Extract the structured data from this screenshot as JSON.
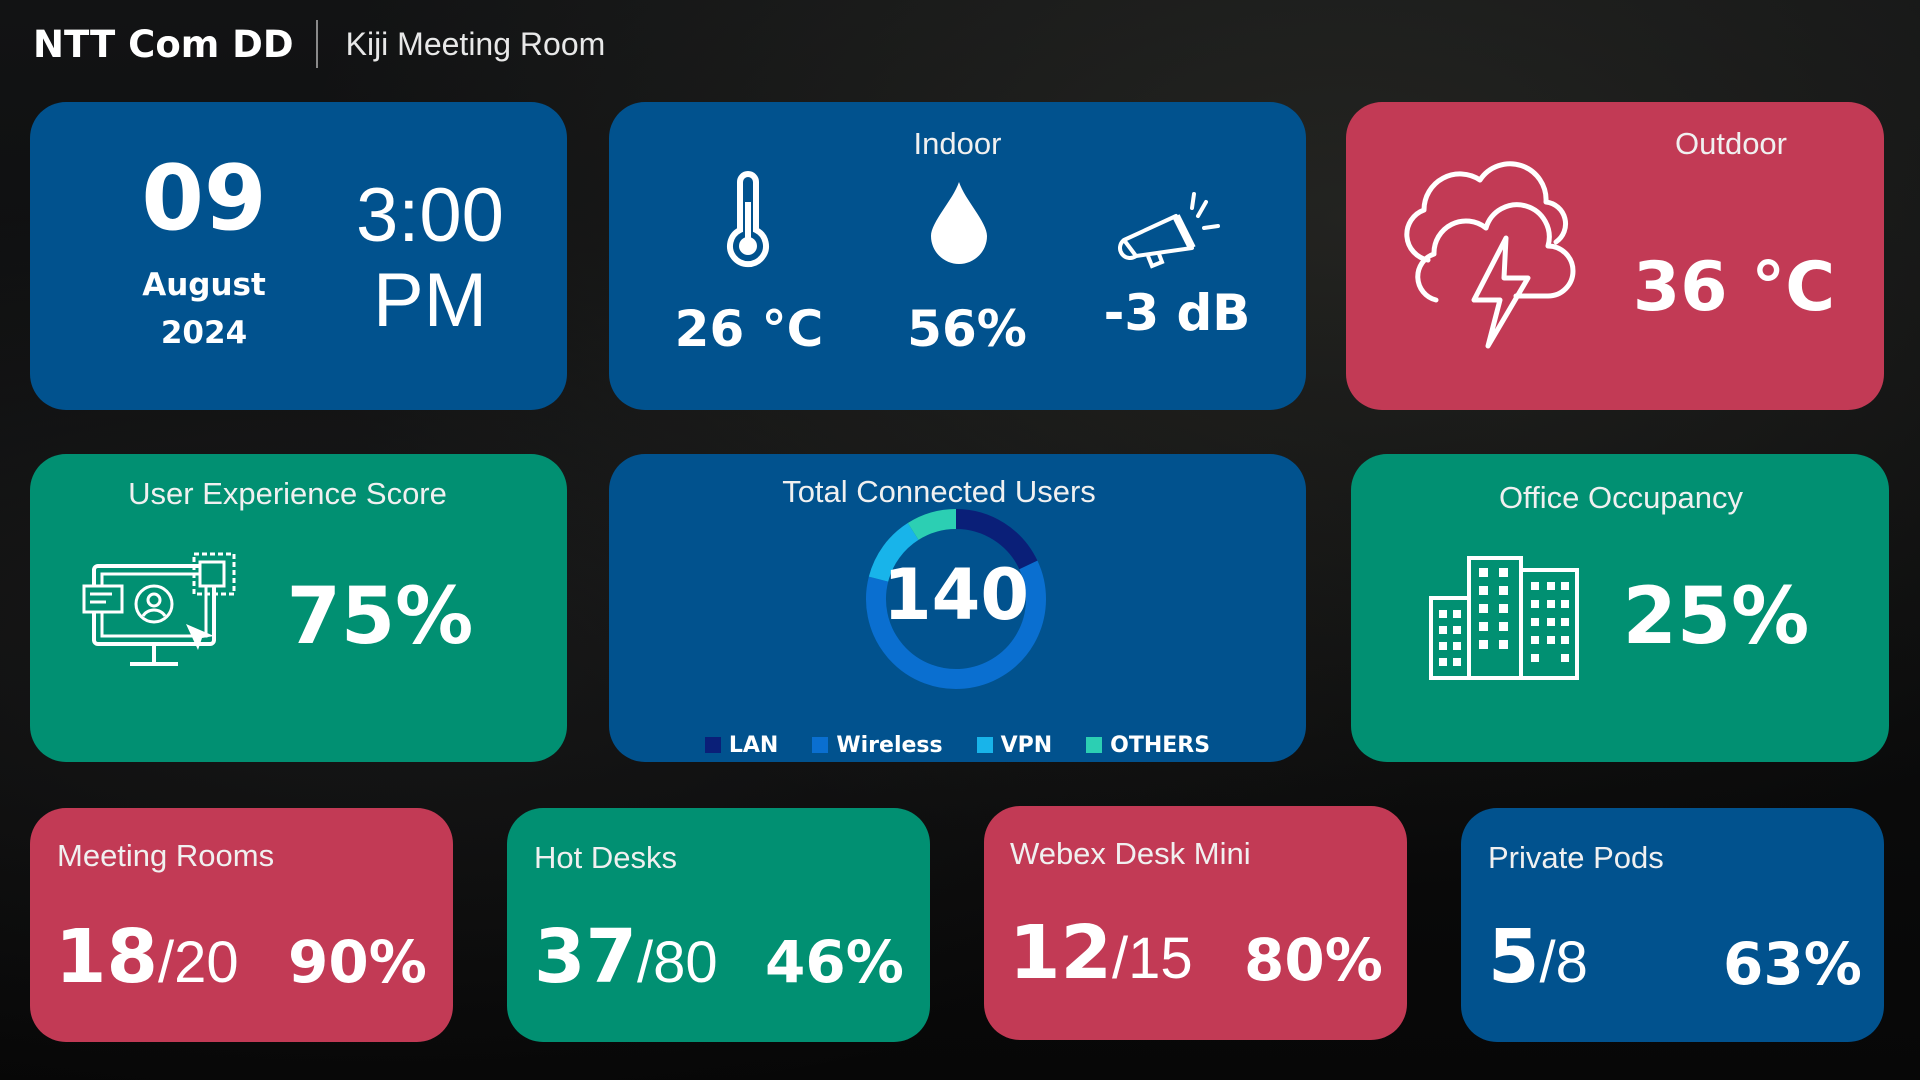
{
  "header": {
    "brand": "NTT Com DD",
    "room": "Kiji Meeting Room"
  },
  "datetime": {
    "day": "09",
    "month": "August",
    "year": "2024",
    "time": "3:00",
    "ampm": "PM"
  },
  "indoor": {
    "title": "Indoor",
    "temperature": "26 °C",
    "humidity": "56%",
    "noise": "-3 dB",
    "icons": [
      "thermometer-icon",
      "water-drop-icon",
      "megaphone-icon"
    ]
  },
  "outdoor": {
    "title": "Outdoor",
    "temperature": "36 °C",
    "icon": "thunderstorm-cloud-icon"
  },
  "user_experience": {
    "title": "User Experience Score",
    "value": "75%",
    "icon": "user-screen-icon"
  },
  "connected_users": {
    "title": "Total Connected Users",
    "total": "140",
    "legend": [
      {
        "label": "LAN",
        "color": "#0a1f78"
      },
      {
        "label": "Wireless",
        "color": "#0a6fd0"
      },
      {
        "label": "VPN",
        "color": "#18b4ea"
      },
      {
        "label": "OTHERS",
        "color": "#2ccfb3"
      }
    ]
  },
  "chart_data": {
    "type": "pie",
    "categories": [
      "LAN",
      "Wireless",
      "VPN",
      "OTHERS"
    ],
    "values": [
      0.18,
      0.61,
      0.12,
      0.09
    ],
    "center_label": "140",
    "title": "Total Connected Users",
    "legend_position": "bottom"
  },
  "office_occupancy": {
    "title": "Office Occupancy",
    "value": "25%",
    "icon": "buildings-icon"
  },
  "meeting_rooms": {
    "title": "Meeting Rooms",
    "used": "18",
    "sep": "/",
    "total": "20",
    "pct": "90%"
  },
  "hot_desks": {
    "title": "Hot Desks",
    "used": "37",
    "sep": "/",
    "total": "80",
    "pct": "46%"
  },
  "webex_desk_mini": {
    "title": "Webex Desk Mini",
    "used": "12",
    "sep": "/",
    "total": "15",
    "pct": "80%"
  },
  "private_pods": {
    "title": "Private Pods",
    "used": "5",
    "sep": "/",
    "total": "8",
    "pct": "63%"
  },
  "colors": {
    "blue": "#01528e",
    "red": "#c23a55",
    "green": "#019072",
    "background": "#0d0e10"
  }
}
